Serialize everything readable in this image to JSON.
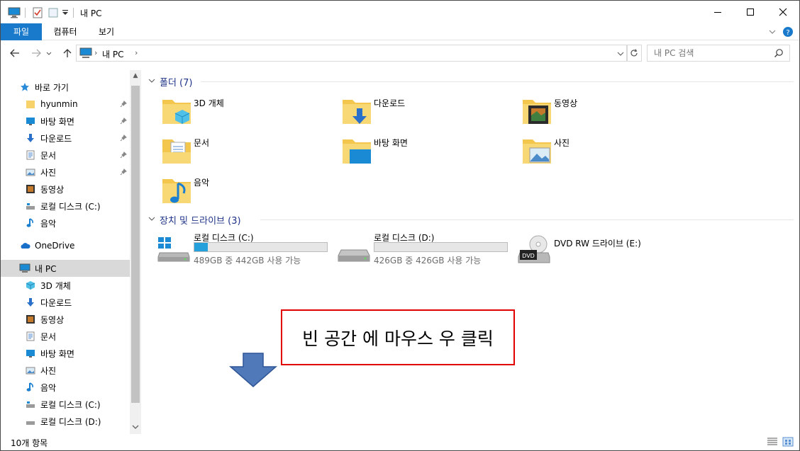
{
  "title": "내 PC",
  "ribbon": {
    "tabs": [
      "파일",
      "컴퓨터",
      "보기"
    ]
  },
  "address": {
    "path": "내 PC"
  },
  "search": {
    "placeholder": "내 PC 검색"
  },
  "sidebar": {
    "items": [
      {
        "label": "바로 가기",
        "icon": "star-icon"
      },
      {
        "label": "hyunmin",
        "icon": "folder-icon",
        "pinned": true
      },
      {
        "label": "바탕 화면",
        "icon": "desktop-icon",
        "pinned": true
      },
      {
        "label": "다운로드",
        "icon": "download-icon",
        "pinned": true
      },
      {
        "label": "문서",
        "icon": "document-icon",
        "pinned": true
      },
      {
        "label": "사진",
        "icon": "picture-icon",
        "pinned": true
      },
      {
        "label": "동영상",
        "icon": "video-icon"
      },
      {
        "label": "로컬 디스크 (C:)",
        "icon": "drive-icon"
      },
      {
        "label": "음악",
        "icon": "music-icon"
      },
      {
        "label": "OneDrive",
        "icon": "cloud-icon"
      },
      {
        "label": "내 PC",
        "icon": "pc-icon"
      },
      {
        "label": "3D 개체",
        "icon": "cube-icon"
      },
      {
        "label": "다운로드",
        "icon": "download-icon"
      },
      {
        "label": "동영상",
        "icon": "video-icon"
      },
      {
        "label": "문서",
        "icon": "document-icon"
      },
      {
        "label": "바탕 화면",
        "icon": "desktop-icon"
      },
      {
        "label": "사진",
        "icon": "picture-icon"
      },
      {
        "label": "음악",
        "icon": "music-icon"
      },
      {
        "label": "로컬 디스크 (C:)",
        "icon": "drive-icon"
      },
      {
        "label": "로컬 디스크 (D:)",
        "icon": "drive-icon"
      }
    ]
  },
  "folders": {
    "header": "폴더 (7)",
    "items": [
      {
        "label": "3D 개체"
      },
      {
        "label": "다운로드"
      },
      {
        "label": "동영상"
      },
      {
        "label": "문서"
      },
      {
        "label": "바탕 화면"
      },
      {
        "label": "사진"
      },
      {
        "label": "음악"
      }
    ]
  },
  "devices": {
    "header": "장치 및 드라이브 (3)",
    "items": [
      {
        "label": "로컬 디스크 (C:)",
        "free": "489GB 중 442GB 사용 가능",
        "used_fraction": 0.1
      },
      {
        "label": "로컬 디스크 (D:)",
        "free": "426GB 중 426GB 사용 가능",
        "used_fraction": 0.0
      },
      {
        "label": "DVD RW 드라이브 (E:)",
        "dvd_text": "DVD"
      }
    ]
  },
  "callout": {
    "text": "빈 공간 에 마우스 우 클릭"
  },
  "status": {
    "count": "10개 항목"
  },
  "colors": {
    "accent": "#1979ca",
    "selected": "#d9d9d9",
    "bar": "#26a0da",
    "callout_border": "#e00000",
    "arrow": "#4f79b8"
  }
}
